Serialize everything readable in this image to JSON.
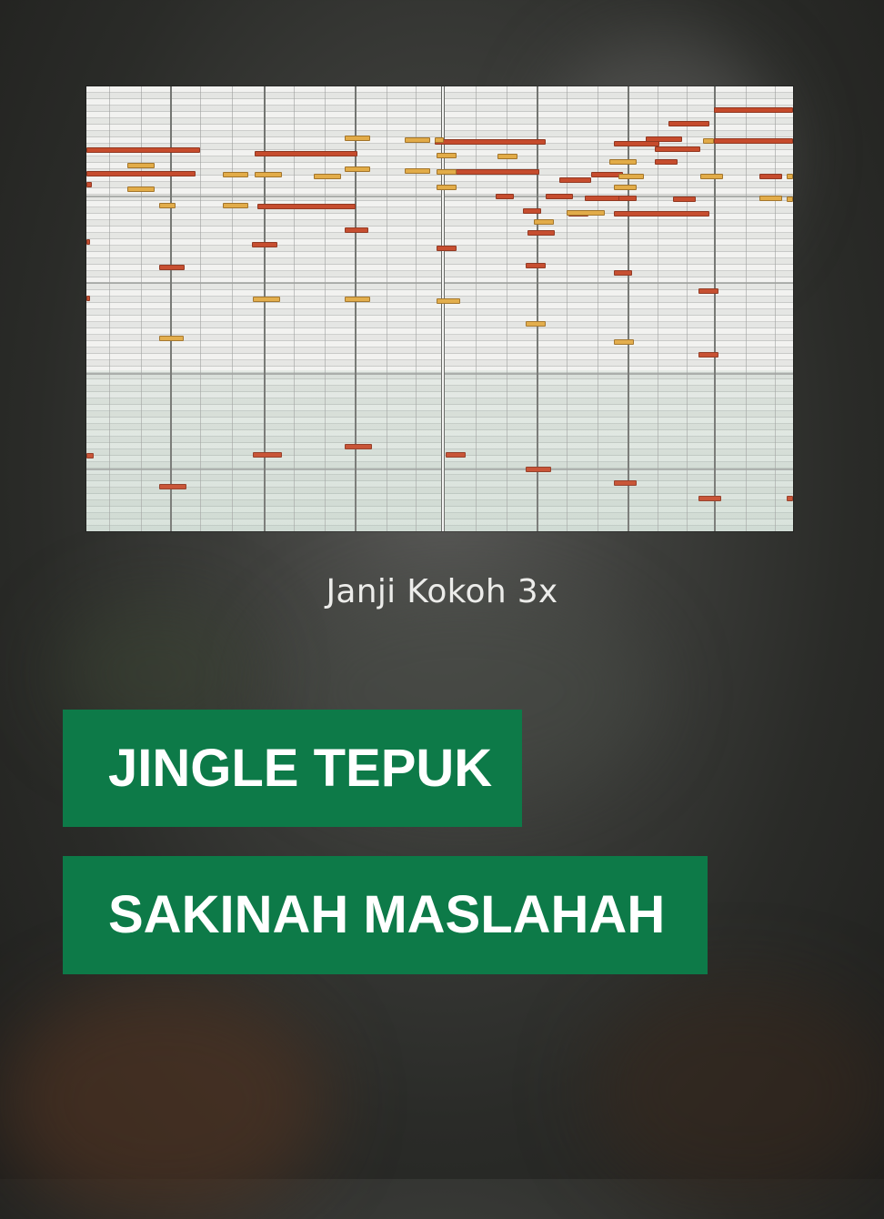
{
  "caption": "Janji Kokoh 3x",
  "titles": {
    "line1": "JINGLE TEPUK",
    "line2": "SAKINAH MASLAHAH"
  },
  "colors": {
    "title_background": "#0d7a48",
    "title_text": "#ffffff",
    "note_red": "#c2401f",
    "note_yellow": "#e0a63c"
  }
}
